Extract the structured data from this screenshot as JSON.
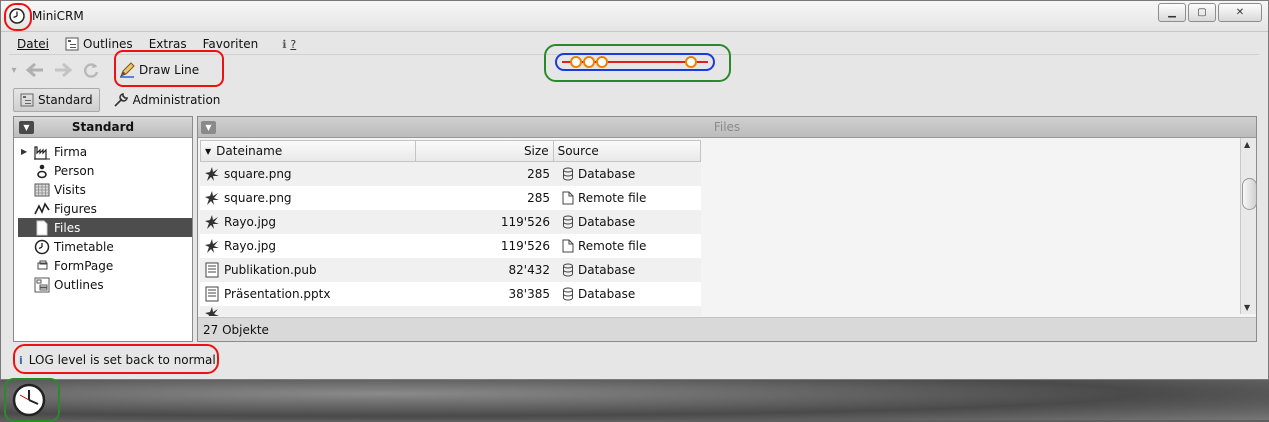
{
  "window": {
    "title": "MiniCRM"
  },
  "menu": {
    "items": [
      "Datei",
      "Outlines",
      "Extras",
      "Favoriten"
    ],
    "help": "?"
  },
  "toolbar": {
    "draw_line_label": "Draw Line"
  },
  "views": {
    "standard": "Standard",
    "administration": "Administration"
  },
  "left_panel": {
    "title": "Standard",
    "tree": [
      {
        "label": "Firma",
        "icon": "factory-icon"
      },
      {
        "label": "Person",
        "icon": "person-icon"
      },
      {
        "label": "Visits",
        "icon": "calendar-grid-icon"
      },
      {
        "label": "Figures",
        "icon": "line-chart-icon"
      },
      {
        "label": "Files",
        "icon": "file-icon",
        "selected": true
      },
      {
        "label": "Timetable",
        "icon": "clock-icon"
      },
      {
        "label": "FormPage",
        "icon": "form-icon"
      },
      {
        "label": "Outlines",
        "icon": "outline-icon"
      }
    ]
  },
  "right_panel": {
    "title": "Files",
    "table": {
      "columns": [
        "Dateiname",
        "Size",
        "Source"
      ],
      "rows": [
        {
          "name": "square.png",
          "size": "285",
          "source": "Database"
        },
        {
          "name": "square.png",
          "size": "285",
          "source": "Remote file"
        },
        {
          "name": "Rayo.jpg",
          "size": "119'526",
          "source": "Database"
        },
        {
          "name": "Rayo.jpg",
          "size": "119'526",
          "source": "Remote file"
        },
        {
          "name": "Publikation.pub",
          "size": "82'432",
          "source": "Database"
        },
        {
          "name": "Präsentation.pptx",
          "size": "38'385",
          "source": "Database"
        }
      ]
    },
    "footer": "27 Objekte"
  },
  "status": {
    "message": "LOG level is set back to normal"
  },
  "colors": {
    "annotation_red": "#e11111",
    "annotation_green": "#2a8a2a",
    "line_blue": "#1a3adf",
    "line_red": "#e02020",
    "node_orange": "#f08000"
  }
}
